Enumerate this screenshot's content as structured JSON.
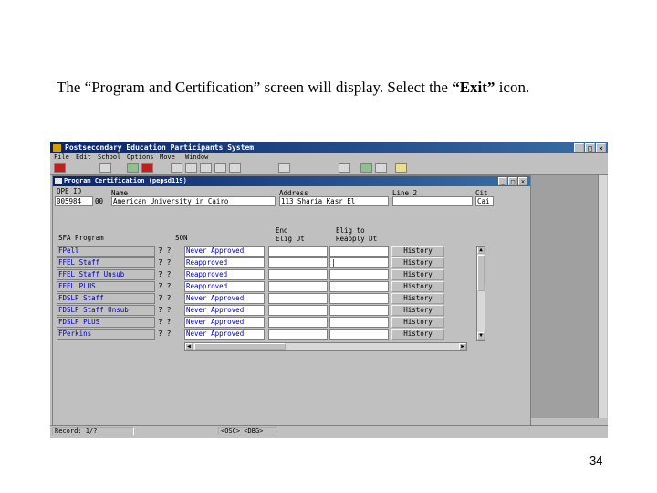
{
  "caption": {
    "pre": "The “Program and Certification” screen will display.  Select the ",
    "bold": "“Exit”",
    "post": " icon."
  },
  "slide_number": "34",
  "app": {
    "title": "Postsecondary Education Participants System",
    "window_buttons": [
      "_",
      "□",
      "×"
    ],
    "menu": [
      "File",
      "Edit",
      "School",
      "Options",
      "Move",
      "Window"
    ]
  },
  "toolbar_icons": [
    "exit-icon",
    "envelope-icon",
    "calendar-icon",
    "tt-icon",
    "ec-icon",
    "view-icon",
    "list-icon",
    "edit-icon",
    "key-icon",
    "arrow-icon",
    "pencil-icon",
    "check-icon",
    "back-arrow-icon",
    "help-icon"
  ],
  "form": {
    "title": "Program Certification (pepsd119)",
    "ope_id_label": "OPE ID",
    "ope_id_value": "005984",
    "ope_id_suffix": "00",
    "name_label": "Name",
    "name_value": "American University in Cairo",
    "address_label": "Address",
    "address_value": "113 Sharia Kasr El",
    "line2_label": "Line 2",
    "line2_value": "",
    "city_label": "Cit",
    "city_value": "Cai",
    "col_program": "SFA Program",
    "col_son": "SON",
    "col_end": "End\nElig Dt",
    "col_reapply": "Elig to\nReapply Dt",
    "rows": [
      {
        "program": "FPell",
        "son": "Never Approved",
        "end": "",
        "reapply": "",
        "history": "History"
      },
      {
        "program": "FFEL Staff",
        "son": "Reapproved",
        "end": "",
        "reapply": "|",
        "history": "History"
      },
      {
        "program": "FFEL Staff Unsub",
        "son": "Reapproved",
        "end": "",
        "reapply": "",
        "history": "History"
      },
      {
        "program": "FFEL PLUS",
        "son": "Reapproved",
        "end": "",
        "reapply": "",
        "history": "History"
      },
      {
        "program": "FDSLP Staff",
        "son": "Never Approved",
        "end": "",
        "reapply": "",
        "history": "History"
      },
      {
        "program": "FDSLP Staff Unsub",
        "son": "Never Approved",
        "end": "",
        "reapply": "",
        "history": "History"
      },
      {
        "program": "FDSLP PLUS",
        "son": "Never Approved",
        "end": "",
        "reapply": "",
        "history": "History"
      },
      {
        "program": "FPerkins",
        "son": "Never Approved",
        "end": "",
        "reapply": "",
        "history": "History"
      }
    ],
    "indicator": "?",
    "indicator2": "?"
  },
  "status": {
    "record": "Record: 1/?",
    "mode": "<OSC> <DBG>"
  }
}
